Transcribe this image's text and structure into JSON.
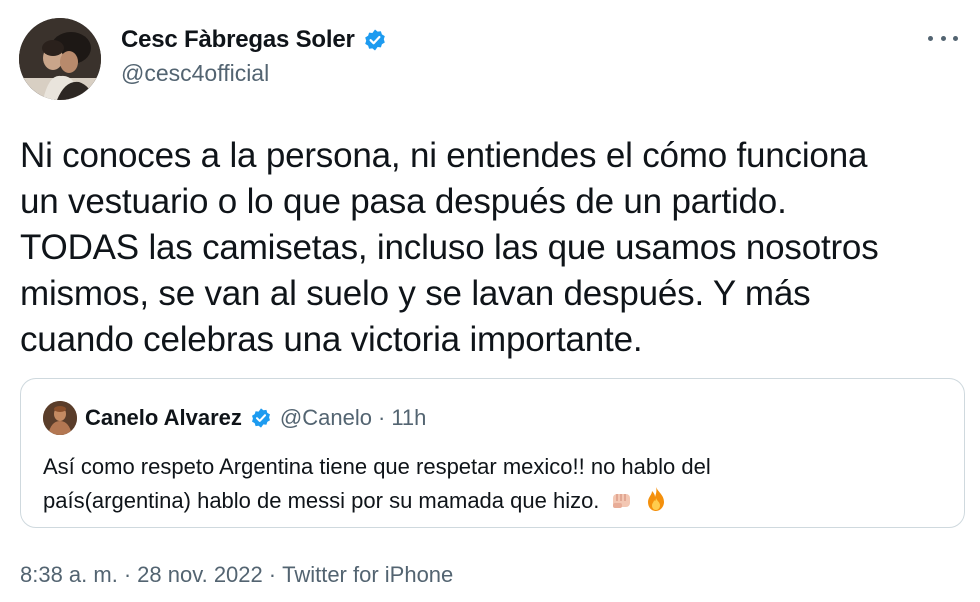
{
  "author": {
    "display_name": "Cesc Fàbregas Soler",
    "handle": "@cesc4official"
  },
  "tweet": {
    "lines": [
      "Ni conoces a la persona, ni entiendes el cómo funciona",
      "un vestuario o lo que pasa después de un partido.",
      "TODAS las camisetas, incluso las que usamos nosotros",
      "mismos, se van al suelo y se lavan después. Y más",
      "cuando celebras una victoria importante."
    ]
  },
  "quote": {
    "display_name": "Canelo Alvarez",
    "handle": "@Canelo",
    "separator": "·",
    "time": "11h",
    "lines": [
      "Así como respeto Argentina tiene que respetar mexico!! no hablo del",
      "país(argentina) hablo de messi por su mamada que hizo."
    ],
    "emojis": [
      "fist-emoji",
      "fire-emoji"
    ]
  },
  "footer": {
    "time": "8:38 a. m.",
    "sep1": "·",
    "date": "28 nov. 2022",
    "sep2": "·",
    "source": "Twitter for iPhone"
  },
  "colors": {
    "verified": "#1d9bf0",
    "secondary_text": "#536471",
    "border": "#cfd9de"
  },
  "icons": {
    "verified": "verified-badge-icon",
    "more": "more-options-icon"
  }
}
